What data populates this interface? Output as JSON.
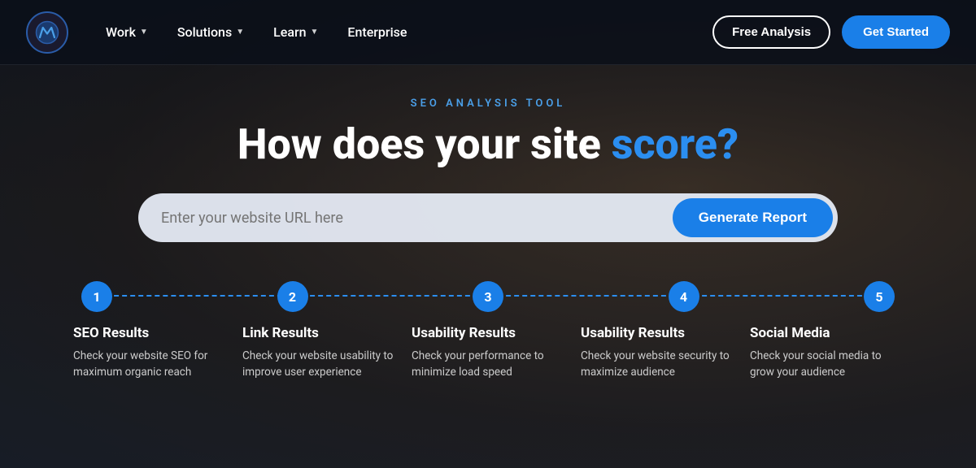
{
  "logo": {
    "alt": "Moz logo"
  },
  "nav": {
    "items": [
      {
        "label": "Work",
        "hasDropdown": true
      },
      {
        "label": "Solutions",
        "hasDropdown": true
      },
      {
        "label": "Learn",
        "hasDropdown": true
      },
      {
        "label": "Enterprise",
        "hasDropdown": false
      }
    ],
    "free_analysis_label": "Free Analysis",
    "get_started_label": "Get Started"
  },
  "hero": {
    "subtitle": "SEO ANALYSIS TOOL",
    "title_text": "How does your site",
    "title_accent": "score?",
    "search_placeholder": "Enter your website URL here",
    "generate_button": "Generate Report"
  },
  "steps": [
    {
      "number": "1",
      "title": "SEO Results",
      "desc": "Check your website SEO for maximum organic reach"
    },
    {
      "number": "2",
      "title": "Link Results",
      "desc": "Check your website usability to improve user experience"
    },
    {
      "number": "3",
      "title": "Usability Results",
      "desc": "Check your performance to minimize load speed"
    },
    {
      "number": "4",
      "title": "Usability Results",
      "desc": "Check your website security to maximize audience"
    },
    {
      "number": "5",
      "title": "Social Media",
      "desc": "Check your social media to grow your audience"
    }
  ]
}
